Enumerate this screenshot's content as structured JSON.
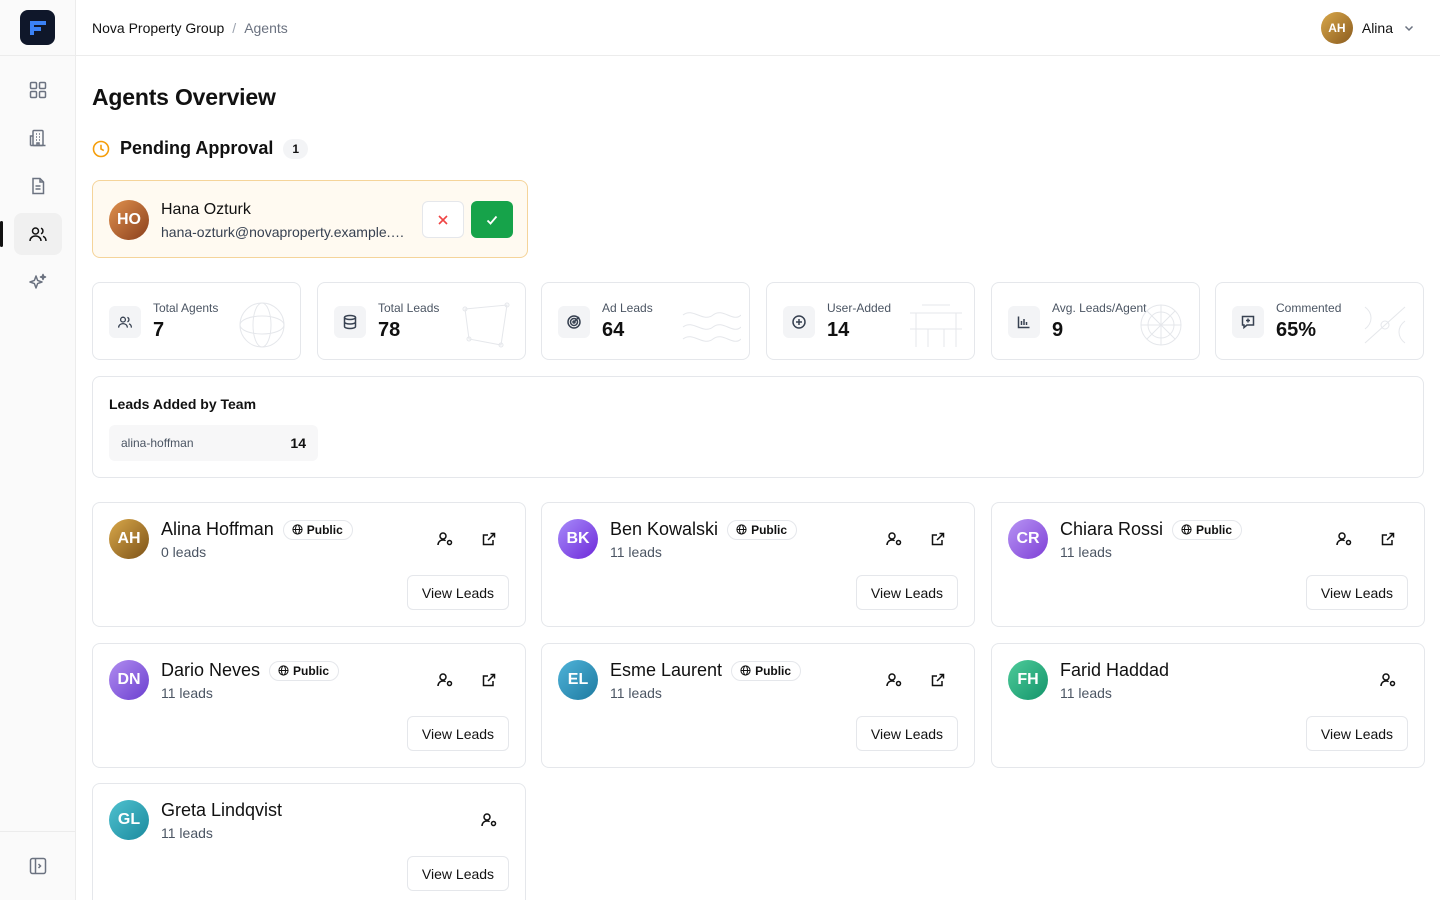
{
  "header": {
    "breadcrumb_root": "Nova Property Group",
    "breadcrumb_sep": "/",
    "breadcrumb_current": "Agents",
    "user_initials": "AH",
    "user_name": "Alina"
  },
  "sidebar": {
    "items": [
      {
        "name": "dashboard",
        "icon": "grid-icon"
      },
      {
        "name": "properties",
        "icon": "building-icon"
      },
      {
        "name": "documents",
        "icon": "document-icon"
      },
      {
        "name": "agents",
        "icon": "users-icon",
        "active": true
      },
      {
        "name": "ai",
        "icon": "sparkles-icon"
      }
    ]
  },
  "page": {
    "title": "Agents Overview"
  },
  "pending": {
    "title": "Pending Approval",
    "count": "1",
    "agent": {
      "initials": "HO",
      "name": "Hana Ozturk",
      "email": "hana-ozturk@novaproperty.example.com"
    }
  },
  "stats": [
    {
      "label": "Total Agents",
      "value": "7",
      "icon": "users-icon"
    },
    {
      "label": "Total Leads",
      "value": "78",
      "icon": "database-icon"
    },
    {
      "label": "Ad Leads",
      "value": "64",
      "icon": "target-icon"
    },
    {
      "label": "User-Added",
      "value": "14",
      "icon": "plus-circle-icon"
    },
    {
      "label": "Avg. Leads/Agent",
      "value": "9",
      "icon": "bar-chart-icon"
    },
    {
      "label": "Commented",
      "value": "65%",
      "icon": "message-icon"
    }
  ],
  "team": {
    "title": "Leads Added by Team",
    "rows": [
      {
        "name": "alina-hoffman",
        "count": "14"
      }
    ]
  },
  "agents": {
    "public_label": "Public",
    "view_label": "View Leads",
    "list": [
      {
        "initials": "AH",
        "name": "Alina Hoffman",
        "leads": "0 leads",
        "public": true
      },
      {
        "initials": "BK",
        "name": "Ben Kowalski",
        "leads": "11 leads",
        "public": true
      },
      {
        "initials": "CR",
        "name": "Chiara Rossi",
        "leads": "11 leads",
        "public": true
      },
      {
        "initials": "DN",
        "name": "Dario Neves",
        "leads": "11 leads",
        "public": true
      },
      {
        "initials": "EL",
        "name": "Esme Laurent",
        "leads": "11 leads",
        "public": true
      },
      {
        "initials": "FH",
        "name": "Farid Haddad",
        "leads": "11 leads",
        "public": false
      },
      {
        "initials": "GL",
        "name": "Greta Lindqvist",
        "leads": "11 leads",
        "public": false
      }
    ]
  },
  "colors": {
    "approve": "#16a34a",
    "reject": "#ef4444",
    "pending_bg": "#fffaf1",
    "pending_border": "#f5d49a",
    "pending_icon": "#f59e0b"
  }
}
